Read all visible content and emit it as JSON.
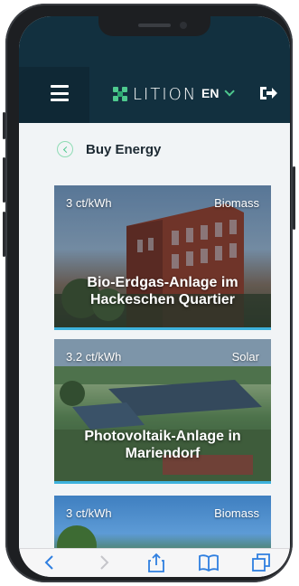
{
  "header": {
    "app_name": "LITION",
    "language": "EN",
    "colors": {
      "background": "#12303f",
      "accent": "#4ec98e"
    }
  },
  "page": {
    "title": "Buy Energy"
  },
  "cards": [
    {
      "price": "3 ct/kWh",
      "type": "Biomass",
      "name": "Bio-Erdgas-Anlage im Hackeschen Quartier"
    },
    {
      "price": "3.2 ct/kWh",
      "type": "Solar",
      "name": "Photovoltaik-Anlage in Mariendorf"
    },
    {
      "price": "3 ct/kWh",
      "type": "Biomass",
      "name": ""
    }
  ],
  "toolbar": {
    "icons": [
      "back-icon",
      "forward-icon",
      "share-icon",
      "bookmarks-icon",
      "tabs-icon"
    ]
  }
}
